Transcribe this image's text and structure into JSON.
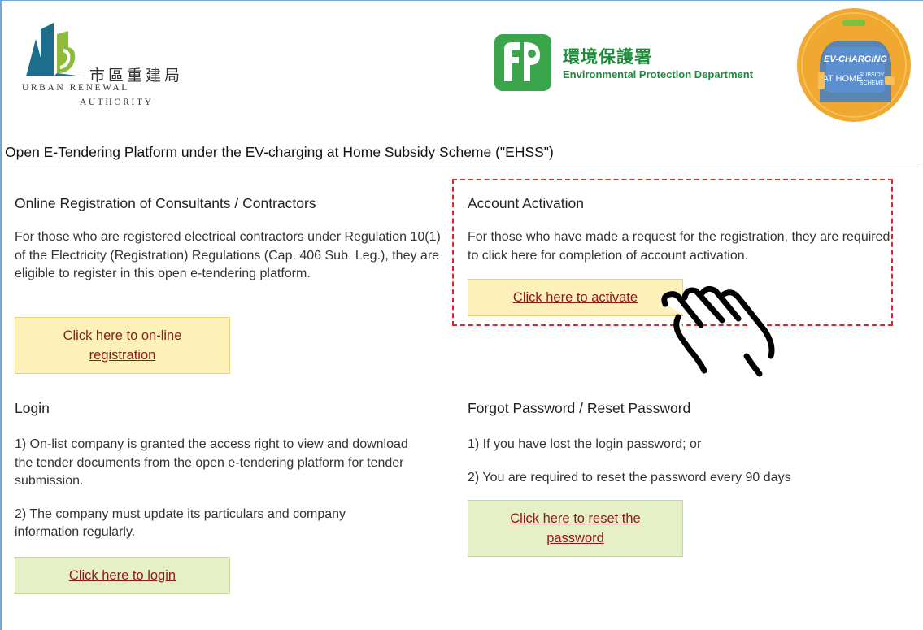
{
  "header": {
    "ura_logo": {
      "zh": "市區重建局",
      "en_line1": "URBAN RENEWAL",
      "en_line2": "AUTHORITY"
    },
    "epd_logo": {
      "zh": "環境保護署",
      "en": "Environmental Protection Department"
    },
    "ehss_badge": {
      "line1": "EV-CHARGING",
      "line2": "AT HOME",
      "line3": "SUBSIDY",
      "line4": "SCHEME"
    }
  },
  "platform_title": "Open E-Tendering Platform under the EV-charging at Home Subsidy Scheme (\"EHSS\")",
  "registration": {
    "title": "Online Registration of Consultants / Contractors",
    "text": "For those who are registered electrical contractors under Regulation 10(1) of the Electricity (Registration) Regulations (Cap. 406 Sub. Leg.), they are eligible to register in this open e-tendering platform.",
    "button_line1": "Click here to on-line",
    "button_line2": "registration"
  },
  "activation": {
    "title": "Account Activation",
    "text": "For those who have made a request for the registration, they are required to click here for completion of account activation.",
    "button": "Click here to activate"
  },
  "login": {
    "title": "Login",
    "text1": "1) On-list company is granted the access right to view and download the tender documents from the open e-tendering platform for tender submission.",
    "text2": "2) The company must update its particulars and company information regularly.",
    "button": "Click here to login"
  },
  "reset": {
    "title": "Forgot Password / Reset Password",
    "text1": "1) If you have lost the login password; or",
    "text2": "2) You are required to reset the password every 90 days",
    "button_line1": "Click here to reset the",
    "button_line2": "password"
  },
  "colors": {
    "link": "#8b1a1a",
    "yellow_button": "#fdf1b9",
    "green_button": "#e5f0c8",
    "highlight_dash": "#e02424",
    "epd_green": "#1f8a3b",
    "ura_teal": "#1c6e8c",
    "badge_orange": "#f0a830"
  },
  "icons": [
    "ura-logo-icon",
    "epd-logo-icon",
    "ehss-badge-icon",
    "pointing-hand-icon"
  ]
}
